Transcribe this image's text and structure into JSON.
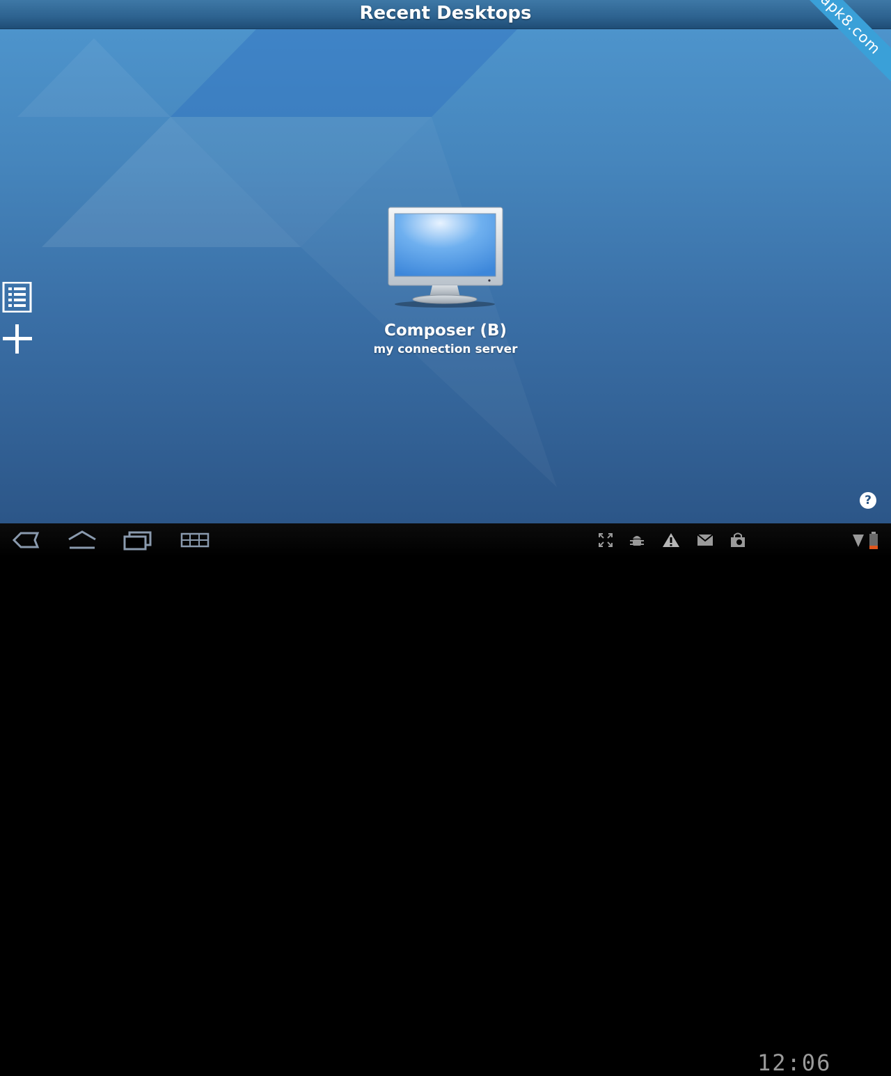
{
  "header": {
    "title": "Recent Desktops"
  },
  "watermark": {
    "text": "apk8.com"
  },
  "sidebar": {
    "list_icon": "list-icon",
    "add_icon": "plus-icon"
  },
  "desktop": {
    "name": "Composer (B)",
    "server": "my connection server",
    "icon": "monitor-icon"
  },
  "help": {
    "label": "?"
  },
  "navbar": {
    "buttons": [
      "back-icon",
      "home-icon",
      "recent-apps-icon",
      "menu-grid-icon"
    ],
    "status_icons": [
      "fullscreen-icon",
      "debug-icon",
      "warning-icon",
      "mail-icon",
      "shopping-bag-icon",
      "wifi-icon",
      "battery-icon"
    ],
    "clock": "12:06"
  },
  "colors": {
    "accent": "#3aa0d8",
    "background_top": "#4f97cf",
    "background_bottom": "#2c5688"
  }
}
